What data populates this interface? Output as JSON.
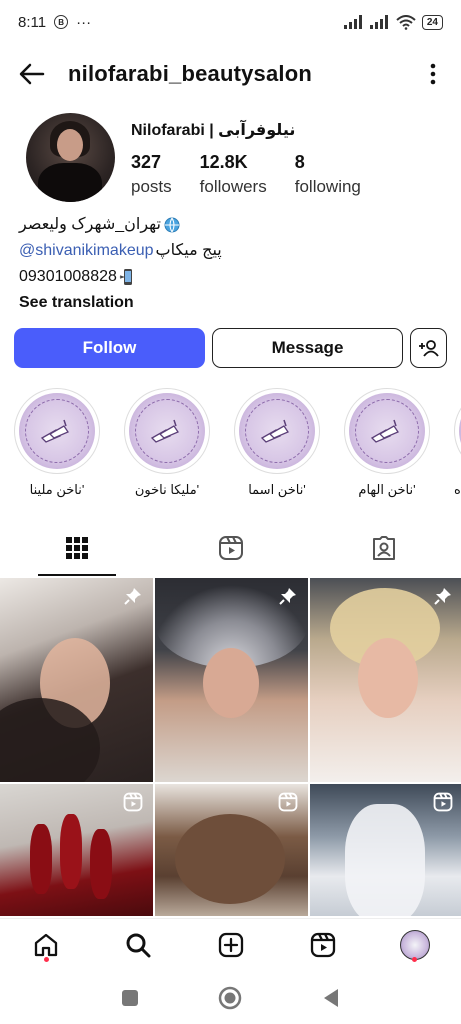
{
  "status_bar": {
    "time": "8:11",
    "b_badge": "B",
    "dots": "···",
    "battery": "24"
  },
  "header": {
    "username": "nilofarabi_beautysalon"
  },
  "profile": {
    "display_name": "Nilofarabi | نیلوفرآبی",
    "stats": [
      {
        "value": "327",
        "label": "posts"
      },
      {
        "value": "12.8K",
        "label": "followers"
      },
      {
        "value": "8",
        "label": "following"
      }
    ],
    "bio": {
      "line1": "تهران_شهرک ولیعصر",
      "line2_link": "@shivanikimakeup",
      "line2_text": " پیج میکاپ",
      "line3": "09301008828",
      "see_translation": "See translation"
    }
  },
  "actions": {
    "follow": "Follow",
    "message": "Message"
  },
  "highlights": [
    {
      "label": "'ناخن ملینا"
    },
    {
      "label": "'ملیکا ناخون"
    },
    {
      "label": "'ناخن اسما"
    },
    {
      "label": "'ناخن الهام"
    },
    {
      "label": "ه"
    }
  ],
  "tabs": [
    {
      "name": "posts-grid",
      "icon": "grid-icon"
    },
    {
      "name": "reels",
      "icon": "reels-icon"
    },
    {
      "name": "tagged",
      "icon": "tagged-icon"
    }
  ],
  "posts": [
    {
      "type": "pinned",
      "icon": "pin-icon"
    },
    {
      "type": "pinned",
      "icon": "pin-icon"
    },
    {
      "type": "pinned",
      "icon": "pin-icon"
    },
    {
      "type": "reel",
      "icon": "reel-icon"
    },
    {
      "type": "reel",
      "icon": "reel-icon"
    },
    {
      "type": "reel",
      "icon": "reel-icon"
    }
  ],
  "colors": {
    "accent": "#4a5dfb",
    "link": "#3b5fb3",
    "notification": "#ff2d4b"
  }
}
